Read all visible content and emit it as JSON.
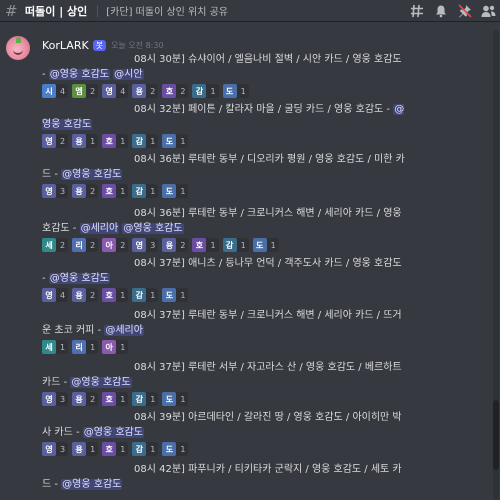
{
  "channel": {
    "name": "떠돌이 | 상인",
    "topic": "[카단] 떠돌이 상인 위치 공유"
  },
  "toolbar_icons": [
    "threads-icon",
    "bell-icon",
    "pin-icon",
    "members-icon"
  ],
  "author": {
    "name": "KorLARK",
    "tag": "봇",
    "time": "오늘 오전 8:30"
  },
  "emoji_colors": {
    "시": "#4a7ec9",
    "엠": "#5c8f3f",
    "영": "#5a5f9e",
    "용": "#5a5f9e",
    "호": "#6b4ea3",
    "감": "#3a6d8c",
    "도": "#4a6fa8",
    "세": "#2f8a8a",
    "리": "#4f6fb0",
    "아": "#8a5ab0"
  },
  "messages": [
    {
      "head": "08시 30분] 슈샤이어 / 엘음나비 절벽 / 시안 카드 / 영웅 호감도 - ",
      "mentions": [
        "@영웅 호감도",
        "@시안"
      ],
      "reactions": [
        {
          "e": "시",
          "n": "4"
        },
        {
          "e": "엠",
          "n": "2"
        },
        {
          "e": "영",
          "n": "4"
        },
        {
          "e": "용",
          "n": "2"
        },
        {
          "e": "호",
          "n": "2"
        },
        {
          "e": "감",
          "n": "1"
        },
        {
          "e": "도",
          "n": "1"
        }
      ]
    },
    {
      "head": "08시 32분] 페이튼 / 칼라자 마을 / 굴딩 카드 / 영웅 호감도 - ",
      "mentions": [
        "@영웅 호감도"
      ],
      "reactions": [
        {
          "e": "영",
          "n": "2"
        },
        {
          "e": "용",
          "n": "1"
        },
        {
          "e": "호",
          "n": "1"
        },
        {
          "e": "감",
          "n": "1"
        },
        {
          "e": "도",
          "n": "1"
        }
      ]
    },
    {
      "head": "08시 36분] 루테란 동부 / 디오리카 평원 / 영웅 호감도 / 미한 카드 - ",
      "mentions": [
        "@영웅 호감도"
      ],
      "reactions": [
        {
          "e": "영",
          "n": "3"
        },
        {
          "e": "용",
          "n": "2"
        },
        {
          "e": "호",
          "n": "1"
        },
        {
          "e": "감",
          "n": "1"
        },
        {
          "e": "도",
          "n": "1"
        }
      ]
    },
    {
      "head": "08시 36분] 루테란 동부 / 크로니커스 해변 / 세리아 카드 / 영웅 호감도 - ",
      "mentions": [
        "@세리아",
        "@영웅 호감도"
      ],
      "reactions": [
        {
          "e": "세",
          "n": "2"
        },
        {
          "e": "리",
          "n": "2"
        },
        {
          "e": "아",
          "n": "2"
        },
        {
          "e": "영",
          "n": "3"
        },
        {
          "e": "용",
          "n": "2"
        },
        {
          "e": "호",
          "n": "1"
        },
        {
          "e": "감",
          "n": "1"
        },
        {
          "e": "도",
          "n": "1"
        }
      ]
    },
    {
      "head": "08시 37분] 애니츠 / 등나무 언덕 / 객주도사 카드 / 영웅 호감도 - ",
      "mentions": [
        "@영웅 호감도"
      ],
      "reactions": [
        {
          "e": "영",
          "n": "4"
        },
        {
          "e": "용",
          "n": "2"
        },
        {
          "e": "호",
          "n": "1"
        },
        {
          "e": "감",
          "n": "1"
        },
        {
          "e": "도",
          "n": "1"
        }
      ]
    },
    {
      "head": "08시 37분] 루테란 동부 / 크로니커스 해변 / 세리아 카드 / 뜨거운 초코 커피 - ",
      "mentions": [
        "@세리아"
      ],
      "reactions": [
        {
          "e": "세",
          "n": "1"
        },
        {
          "e": "리",
          "n": "1"
        },
        {
          "e": "아",
          "n": "1"
        }
      ]
    },
    {
      "head": "08시 37분] 루테란 서부 / 자고라스 산 / 영웅 호감도 / 베르하트 카드 - ",
      "mentions": [
        "@영웅 호감도"
      ],
      "reactions": [
        {
          "e": "영",
          "n": "3"
        },
        {
          "e": "용",
          "n": "2"
        },
        {
          "e": "호",
          "n": "1"
        },
        {
          "e": "감",
          "n": "1"
        },
        {
          "e": "도",
          "n": "1"
        }
      ]
    },
    {
      "head": "08시 39분] 아르데타인 / 갈라진 땅 / 영웅 호감도 / 아이히만 박사 카드 - ",
      "mentions": [
        "@영웅 호감도"
      ],
      "reactions": [
        {
          "e": "영",
          "n": "3"
        },
        {
          "e": "용",
          "n": "1"
        },
        {
          "e": "호",
          "n": "1"
        },
        {
          "e": "감",
          "n": "1"
        },
        {
          "e": "도",
          "n": "1"
        }
      ]
    },
    {
      "head": "08시 42분] 파푸니카 / 티키타카 군락지 / 영웅 호감도 / 세토 카드 - ",
      "mentions": [
        "@영웅 호감도"
      ],
      "reactions": []
    }
  ]
}
